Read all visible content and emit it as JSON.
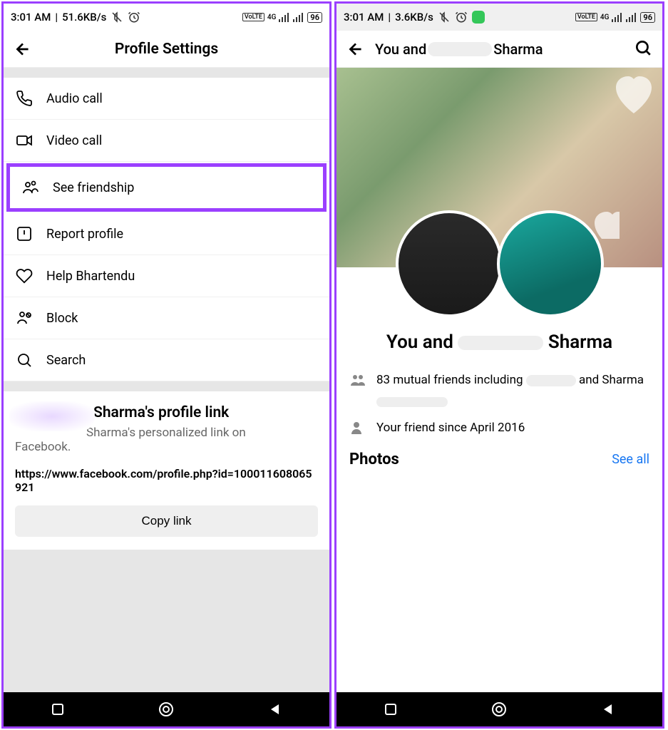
{
  "left": {
    "status": {
      "time": "3:01 AM",
      "speed": "51.6KB/s",
      "battery": "96"
    },
    "header": {
      "title": "Profile Settings"
    },
    "menu": [
      {
        "icon": "phone-icon",
        "label": "Audio call"
      },
      {
        "icon": "video-icon",
        "label": "Video call"
      },
      {
        "icon": "friendship-icon",
        "label": "See friendship",
        "highlighted": true
      },
      {
        "icon": "report-icon",
        "label": "Report profile"
      },
      {
        "icon": "heart-icon",
        "label": "Help Bhartendu"
      },
      {
        "icon": "block-icon",
        "label": "Block"
      },
      {
        "icon": "search-icon",
        "label": "Search"
      }
    ],
    "link_section": {
      "title": "Sharma's profile link",
      "subtitle1": "Sharma's personalized link on",
      "subtitle2": "Facebook.",
      "url": "https://www.facebook.com/profile.php?id=100011608065921",
      "copy_label": "Copy link"
    }
  },
  "right": {
    "status": {
      "time": "3:01 AM",
      "speed": "3.6KB/s",
      "battery": "96"
    },
    "header": {
      "prefix": "You and",
      "name": "Sharma"
    },
    "friendship_title_prefix": "You and",
    "friendship_title_name": "Sharma",
    "mutual_friends_prefix": "83 mutual friends including",
    "mutual_friends_suffix": "and Sharma",
    "friend_since": "Your friend since April 2016",
    "photos": {
      "title": "Photos",
      "see_all": "See all"
    }
  }
}
